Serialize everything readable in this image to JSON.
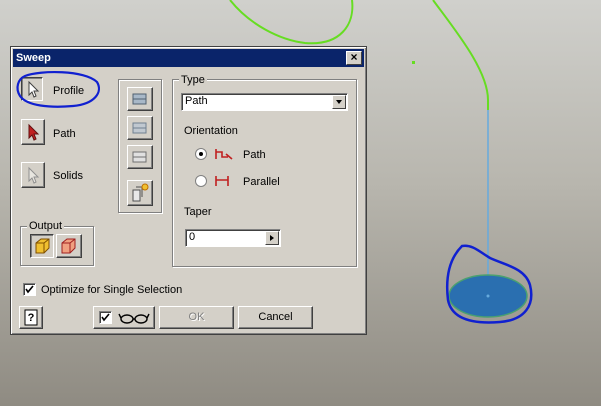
{
  "dialog": {
    "title": "Sweep",
    "close_glyph": "×"
  },
  "selectors": {
    "profile_label": "Profile",
    "path_label": "Path",
    "solids_label": "Solids"
  },
  "output": {
    "label": "Output",
    "options": [
      "solid-output-icon",
      "surface-output-icon"
    ]
  },
  "type": {
    "label": "Type",
    "selected": "Path"
  },
  "orientation": {
    "label": "Orientation",
    "options": [
      {
        "label": "Path",
        "checked": true
      },
      {
        "label": "Parallel",
        "checked": false
      }
    ]
  },
  "taper": {
    "label": "Taper",
    "value": "0"
  },
  "optimize": {
    "label": "Optimize for Single Selection",
    "checked": true
  },
  "footer": {
    "ok_label": "OK",
    "cancel_label": "Cancel"
  },
  "colors": {
    "path_curve": "#66dd22",
    "path_line": "#66aadd",
    "profile_fill": "#2a6fb0",
    "annotation": "#1020d0",
    "selector_arrow": "#c02020"
  }
}
